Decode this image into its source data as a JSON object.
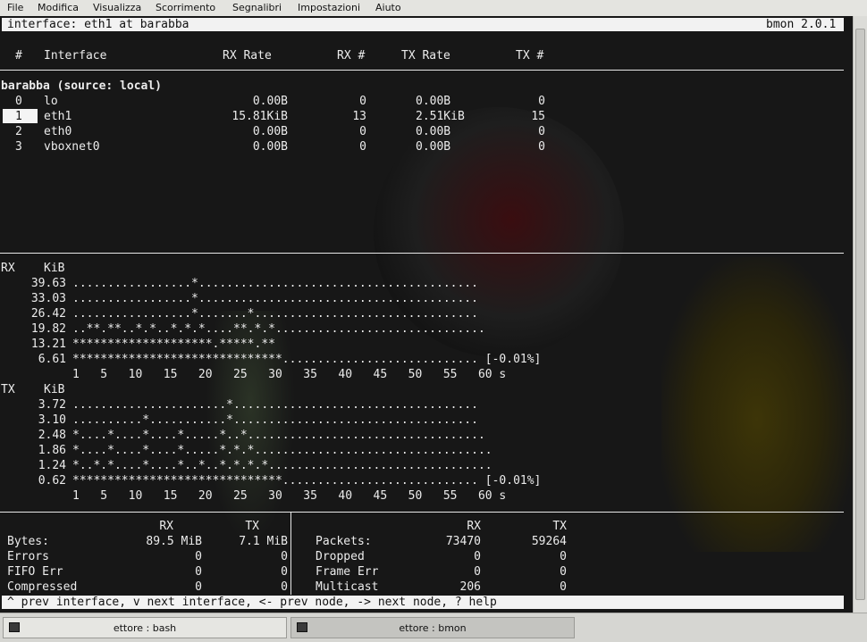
{
  "menubar": [
    "File",
    "Modifica",
    "Visualizza",
    "Scorrimento",
    "Segnalibri",
    "Impostazioni",
    "Aiuto"
  ],
  "header": {
    "title": "interface: eth1 at barabba",
    "version": "bmon 2.0.1"
  },
  "table": {
    "columns": [
      "#",
      "Interface",
      "RX Rate",
      "RX #",
      "TX Rate",
      "TX #"
    ],
    "node": "barabba (source: local)",
    "rows": [
      {
        "idx": "0",
        "name": "lo",
        "rx_rate": "0.00B",
        "rx_num": "0",
        "tx_rate": "0.00B",
        "tx_num": "0"
      },
      {
        "idx": "1",
        "name": "eth1",
        "rx_rate": "15.81KiB",
        "rx_num": "13",
        "tx_rate": "2.51KiB",
        "tx_num": "15"
      },
      {
        "idx": "2",
        "name": "eth0",
        "rx_rate": "0.00B",
        "rx_num": "0",
        "tx_rate": "0.00B",
        "tx_num": "0"
      },
      {
        "idx": "3",
        "name": "vboxnet0",
        "rx_rate": "0.00B",
        "rx_num": "0",
        "tx_rate": "0.00B",
        "tx_num": "0"
      }
    ],
    "selected_index": 1
  },
  "graph_rx": {
    "label": "RX",
    "unit": "KiB",
    "rows": [
      {
        "value": "39.63",
        "plot": ".................*........................................"
      },
      {
        "value": "33.03",
        "plot": ".................*........................................"
      },
      {
        "value": "26.42",
        "plot": ".................*.......*................................"
      },
      {
        "value": "19.82",
        "plot": "..**.**..*.*..*.*.*....**.*.*.............................."
      },
      {
        "value": "13.21",
        "plot": "********************.*****.**"
      },
      {
        "value": "6.61",
        "plot": "******************************............................ [-0.01%]"
      }
    ],
    "axis": "1   5   10   15   20   25   30   35   40   45   50   55   60 s"
  },
  "graph_tx": {
    "label": "TX",
    "unit": "KiB",
    "rows": [
      {
        "value": "3.72",
        "plot": "......................*..................................."
      },
      {
        "value": "3.10",
        "plot": "..........*...........*..................................."
      },
      {
        "value": "2.48",
        "plot": "*....*....*....*.....*..*.................................."
      },
      {
        "value": "1.86",
        "plot": "*....*....*....*.....*.*.*.................................."
      },
      {
        "value": "1.24",
        "plot": "*..*.*....*....*..*..*.*.*.*................................"
      },
      {
        "value": "0.62",
        "plot": "******************************............................ [-0.01%]"
      }
    ],
    "axis": "1   5   10   15   20   25   30   35   40   45   50   55   60 s"
  },
  "stats_left": {
    "headers": [
      "RX",
      "TX"
    ],
    "rows": [
      {
        "label": "Bytes:",
        "rx": "89.5 MiB",
        "tx": "7.1 MiB"
      },
      {
        "label": "Errors",
        "rx": "0",
        "tx": "0"
      },
      {
        "label": "FIFO Err",
        "rx": "0",
        "tx": "0"
      },
      {
        "label": "Compressed",
        "rx": "0",
        "tx": "0"
      }
    ]
  },
  "stats_right": {
    "headers": [
      "RX",
      "TX"
    ],
    "rows": [
      {
        "label": "Packets:",
        "rx": "73470",
        "tx": "59264"
      },
      {
        "label": "Dropped",
        "rx": "0",
        "tx": "0"
      },
      {
        "label": "Frame Err",
        "rx": "0",
        "tx": "0"
      },
      {
        "label": "Multicast",
        "rx": "206",
        "tx": "0"
      }
    ]
  },
  "help": "^ prev interface, v next interface, <- prev node, -> next node, ? help",
  "taskbar": [
    "ettore : bash",
    "ettore : bmon"
  ],
  "taskbar_active": 1
}
